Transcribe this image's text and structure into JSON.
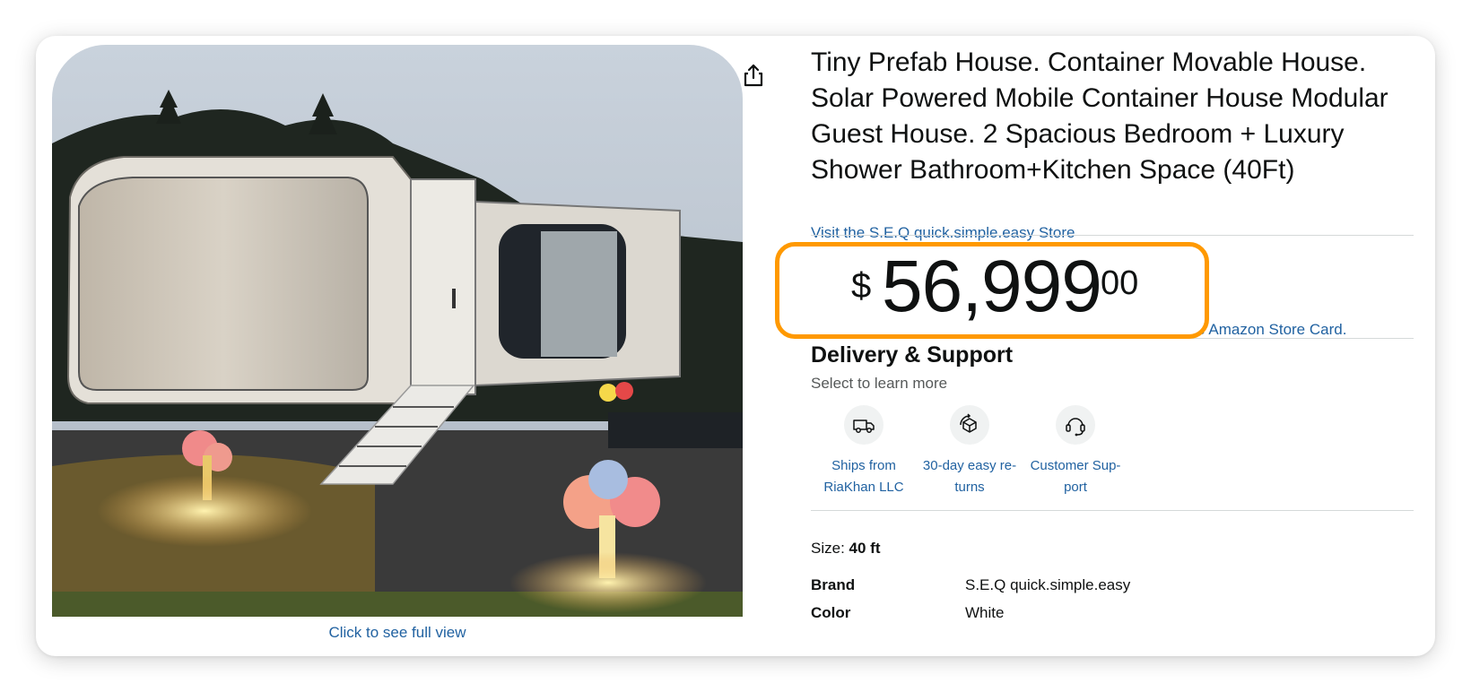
{
  "product": {
    "title": "Tiny Prefab House. Container Movable House. Solar Powered Mobile Container House Modular Guest House. 2 Spacious Bedroom + Luxury Shower Bathroom+Kitchen Space (40Ft)",
    "store_link": "Visit the S.E.Q quick.simple.easy Store",
    "image_action": "Click to see full view"
  },
  "price": {
    "symbol": "$",
    "whole": "56,999",
    "fraction": "00",
    "card_promo": "the Amazon Store Card."
  },
  "delivery": {
    "heading": "Delivery & Support",
    "subtitle": "Select to learn more",
    "features": [
      {
        "icon": "truck-icon",
        "label": "Ships from RiaKhan LLC"
      },
      {
        "icon": "return-box-icon",
        "label": "30-day easy re- turns"
      },
      {
        "icon": "headset-icon",
        "label": "Customer Sup- port"
      }
    ]
  },
  "size": {
    "label": "Size:",
    "value": "40 ft"
  },
  "specs": [
    {
      "key": "Brand",
      "value": "S.E.Q quick.simple.easy"
    },
    {
      "key": "Color",
      "value": "White"
    }
  ],
  "colors": {
    "link": "#2162A1",
    "highlight": "#FF9900",
    "text": "#0F1111"
  }
}
